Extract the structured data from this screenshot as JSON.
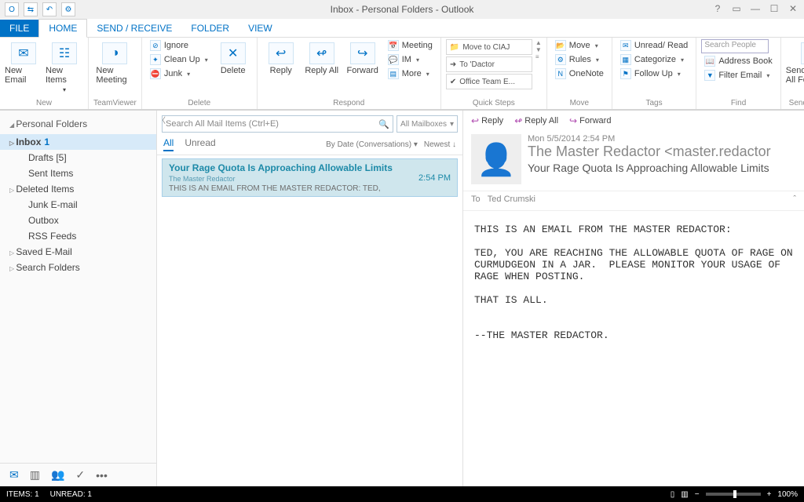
{
  "window": {
    "title": "Inbox - Personal Folders - Outlook"
  },
  "tabs": {
    "file": "FILE",
    "home": "HOME",
    "sendreceive": "SEND / RECEIVE",
    "folder": "FOLDER",
    "view": "VIEW"
  },
  "ribbon": {
    "new": {
      "label": "New",
      "email": "New Email",
      "items": "New Items"
    },
    "tv": {
      "label": "TeamViewer",
      "meeting": "New Meeting"
    },
    "delete": {
      "label": "Delete",
      "ignore": "Ignore",
      "cleanup": "Clean Up",
      "junk": "Junk",
      "delete": "Delete"
    },
    "respond": {
      "label": "Respond",
      "reply": "Reply",
      "replyall": "Reply All",
      "forward": "Forward",
      "meeting": "Meeting",
      "im": "IM",
      "more": "More"
    },
    "quicksteps": {
      "label": "Quick Steps",
      "a": "Move to CIAJ",
      "b": "To 'Dactor",
      "c": "Office Team E..."
    },
    "move": {
      "label": "Move",
      "move": "Move",
      "rules": "Rules",
      "onenote": "OneNote"
    },
    "tags": {
      "label": "Tags",
      "unread": "Unread/ Read",
      "categorize": "Categorize",
      "followup": "Follow Up"
    },
    "find": {
      "label": "Find",
      "placeholder": "Search People",
      "address": "Address Book",
      "filter": "Filter Email"
    },
    "sr": {
      "label": "Send/Receive",
      "srall": "Send/Receive All Folders"
    }
  },
  "nav": {
    "root": "Personal Folders",
    "inbox": "Inbox",
    "inbox_count": "1",
    "drafts": "Drafts [5]",
    "sent": "Sent Items",
    "deleted": "Deleted Items",
    "junk": "Junk E-mail",
    "outbox": "Outbox",
    "rss": "RSS Feeds",
    "saved": "Saved E-Mail",
    "search": "Search Folders"
  },
  "listpane": {
    "search_placeholder": "Search All Mail Items (Ctrl+E)",
    "scope": "All Mailboxes",
    "tab_all": "All",
    "tab_unread": "Unread",
    "sort_by": "By Date (Conversations)",
    "sort_order": "Newest ↓",
    "item": {
      "subject": "Your Rage Quota Is Approaching Allowable Limits",
      "sender": "The Master Redactor",
      "preview": "THIS IS AN EMAIL FROM THE MASTER REDACTOR:  TED,",
      "time": "2:54 PM"
    }
  },
  "read": {
    "reply": "Reply",
    "replyall": "Reply All",
    "forward": "Forward",
    "date": "Mon 5/5/2014 2:54 PM",
    "from": "The Master Redactor <master.redactor",
    "subject": "Your Rage Quota Is Approaching Allowable Limits",
    "to_label": "To",
    "to": "Ted Crumski",
    "body": "THIS IS AN EMAIL FROM THE MASTER REDACTOR:\n\nTED, YOU ARE REACHING THE ALLOWABLE QUOTA OF RAGE ON CURMUDGEON IN A JAR.  PLEASE MONITOR YOUR USAGE OF RAGE WHEN POSTING.\n\nTHAT IS ALL.\n\n\n--THE MASTER REDACTOR."
  },
  "status": {
    "items": "ITEMS: 1",
    "unread": "UNREAD: 1",
    "zoom": "100%"
  }
}
